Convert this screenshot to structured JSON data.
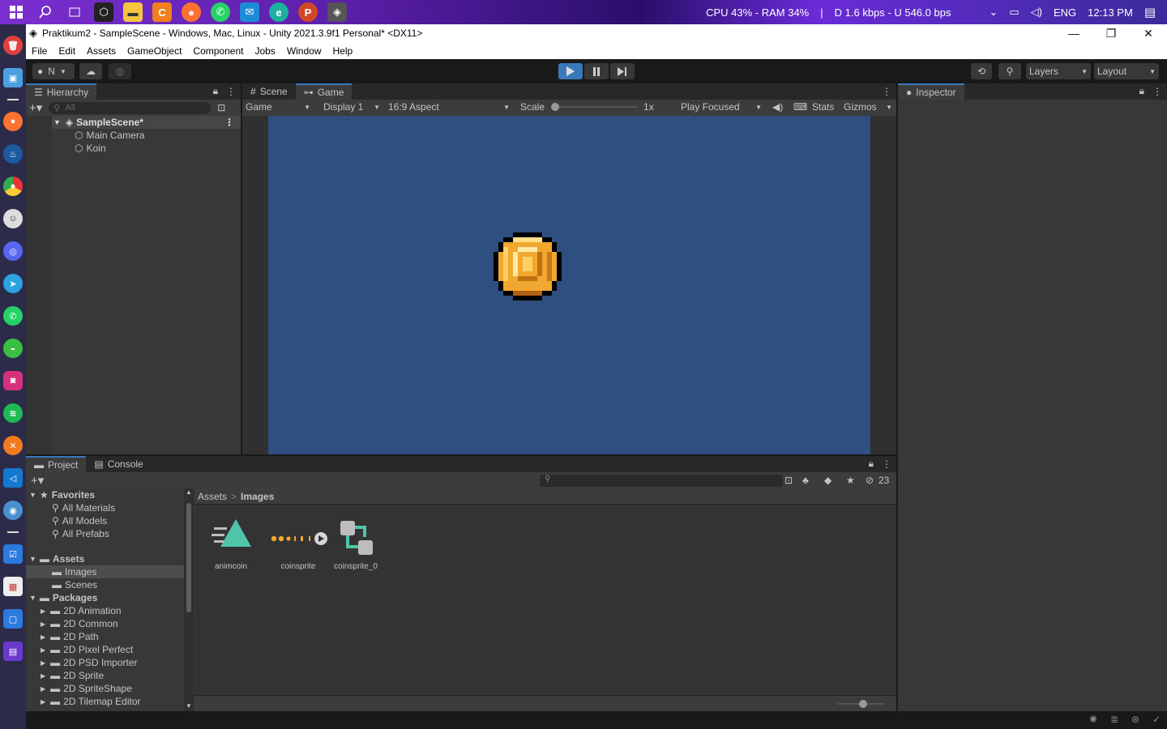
{
  "taskbar": {
    "stats": "CPU 43% - RAM 34%",
    "separator": "|",
    "network": "D 1.6 kbps - U 546.0 bps",
    "lang": "ENG",
    "time": "12:13 PM"
  },
  "window": {
    "title": "Praktikum2 - SampleScene - Windows, Mac, Linux - Unity 2021.3.9f1 Personal* <DX11>"
  },
  "menu": [
    "File",
    "Edit",
    "Assets",
    "GameObject",
    "Component",
    "Jobs",
    "Window",
    "Help"
  ],
  "toolbar": {
    "account": "N",
    "layers": "Layers",
    "layout": "Layout"
  },
  "hierarchy": {
    "tab": "Hierarchy",
    "search_placeholder": "All",
    "scene": "SampleScene*",
    "items": [
      "Main Camera",
      "Koin"
    ]
  },
  "game": {
    "tabs": [
      "Scene",
      "Game"
    ],
    "view_mode": "Game",
    "display": "Display 1",
    "aspect": "16:9 Aspect",
    "scale_label": "Scale",
    "scale_value": "1x",
    "play_mode": "Play Focused",
    "stats": "Stats",
    "gizmos": "Gizmos",
    "bg_color": "#2f4f80"
  },
  "inspector": {
    "tab": "Inspector"
  },
  "project": {
    "tabs": [
      "Project",
      "Console"
    ],
    "hidden_count": "23",
    "favorites_label": "Favorites",
    "favorites": [
      "All Materials",
      "All Models",
      "All Prefabs"
    ],
    "assets_label": "Assets",
    "assets_children": [
      "Images",
      "Scenes"
    ],
    "packages_label": "Packages",
    "packages": [
      "2D Animation",
      "2D Common",
      "2D Path",
      "2D Pixel Perfect",
      "2D PSD Importer",
      "2D Sprite",
      "2D SpriteShape",
      "2D Tilemap Editor"
    ],
    "breadcrumb": [
      "Assets",
      "Images"
    ],
    "breadcrumb_sep": ">",
    "files": [
      "animcoin",
      "coinsprite",
      "coinsprite_0"
    ]
  },
  "colors": {
    "accent": "#3a79bb",
    "teal": "#4fc4a8",
    "coin": "#f0a830"
  }
}
